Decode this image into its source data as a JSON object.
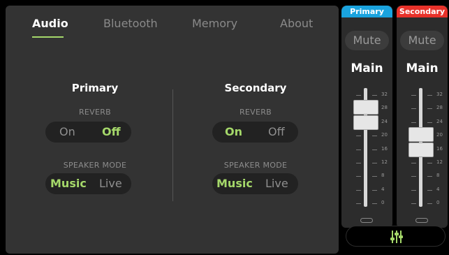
{
  "tabs": [
    {
      "label": "Audio",
      "active": true
    },
    {
      "label": "Bluetooth",
      "active": false
    },
    {
      "label": "Memory",
      "active": false
    },
    {
      "label": "About",
      "active": false
    }
  ],
  "primary": {
    "title": "Primary",
    "reverb_label": "REVERB",
    "reverb_on": "On",
    "reverb_off": "Off",
    "reverb_selected": "Off",
    "mode_label": "SPEAKER MODE",
    "mode_music": "Music",
    "mode_live": "Live",
    "mode_selected": "Music"
  },
  "secondary": {
    "title": "Secondary",
    "reverb_label": "REVERB",
    "reverb_on": "On",
    "reverb_off": "Off",
    "reverb_selected": "On",
    "mode_label": "SPEAKER MODE",
    "mode_music": "Music",
    "mode_live": "Live",
    "mode_selected": "Music"
  },
  "mixer": {
    "channels": [
      {
        "tag": "Primary",
        "tag_color": "#1aa3de",
        "mute": "Mute",
        "label": "Main",
        "level": 26
      },
      {
        "tag": "Secondary",
        "tag_color": "#e8322a",
        "mute": "Mute",
        "label": "Main",
        "level": 18
      }
    ],
    "scale": [
      "32",
      "28",
      "24",
      "20",
      "16",
      "12",
      "8",
      "4",
      "0"
    ],
    "bottom_icon": "mixer-sliders-icon"
  },
  "colors": {
    "accent": "#a5d86a",
    "panel": "#333333"
  }
}
